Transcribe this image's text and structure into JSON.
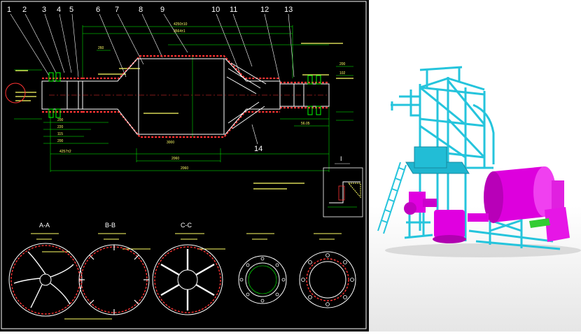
{
  "drawing": {
    "callouts": [
      "1",
      "2",
      "3",
      "4",
      "5",
      "6",
      "7",
      "8",
      "9",
      "10",
      "11",
      "12",
      "13",
      "14"
    ],
    "detail_label": "I",
    "sections": [
      "A-A",
      "B-B",
      "C-C"
    ],
    "dimensions": [
      "4250±10",
      "3564±1",
      "2060",
      "2060",
      "200",
      "220",
      "115",
      "200",
      "3000",
      "260",
      "4257±2",
      "56.05",
      "200",
      "102"
    ]
  },
  "colors": {
    "cad_background": "#000000",
    "shell": "#ffffff",
    "dimension": "#00ff00",
    "hatch": "#ff3333",
    "section": "#00ffff",
    "text": "#ffff66",
    "render_frame": "#25c4dc",
    "render_body": "#e000e0"
  }
}
